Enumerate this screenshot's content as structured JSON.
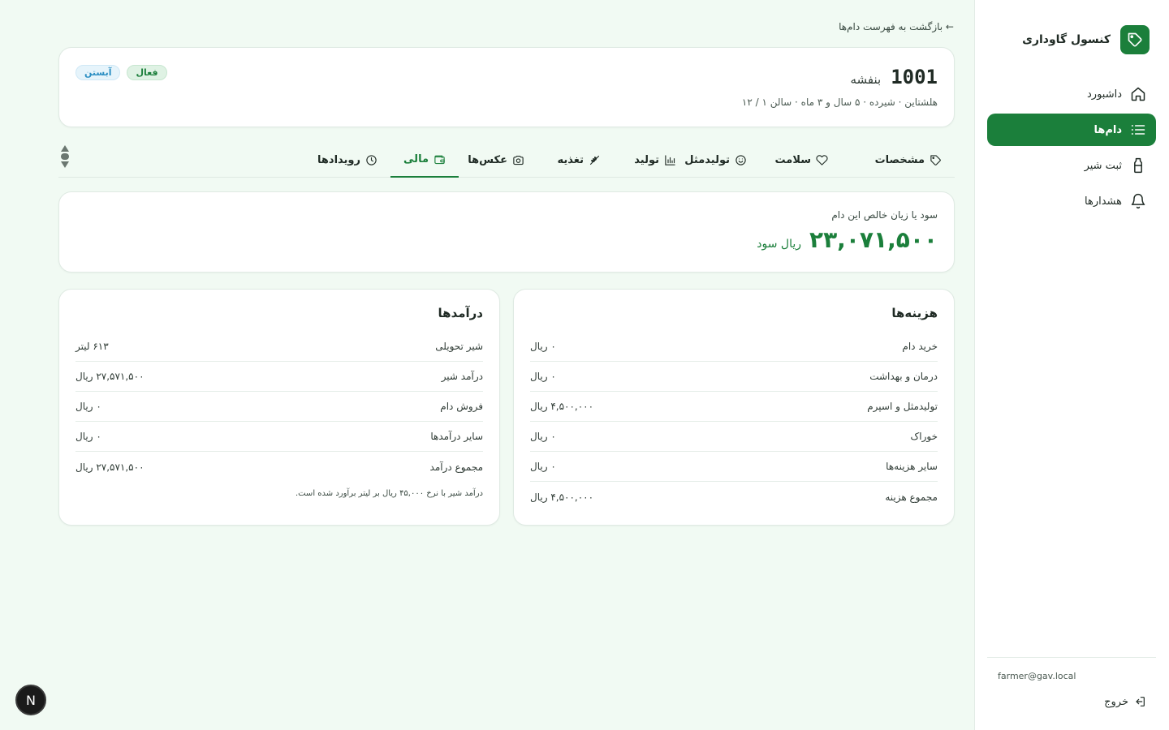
{
  "sidebar": {
    "brand": "کنسول گاوداری",
    "items": [
      {
        "label": "داشبورد",
        "icon": "home-icon",
        "active": false
      },
      {
        "label": "دام‌ها",
        "icon": "list-icon",
        "active": true
      },
      {
        "label": "ثبت شیر",
        "icon": "bottle-icon",
        "active": false
      },
      {
        "label": "هشدارها",
        "icon": "bell-icon",
        "active": false
      }
    ],
    "user_email": "farmer@gav.local",
    "logout_label": "خروج"
  },
  "back_link": "← بازگشت به فهرست دام‌ها",
  "animal": {
    "id": "1001",
    "name": "بنفشه",
    "info": "هلشتاین · شیرده · ۵ سال و ۳ ماه · سالن ۱ / ۱۲",
    "badges": {
      "active": "فعال",
      "pregnant": "آبستن"
    }
  },
  "tabs": [
    {
      "label": "مشخصات",
      "icon": "tag-icon"
    },
    {
      "label": "سلامت",
      "icon": "heart-icon"
    },
    {
      "label": "تولیدمثل",
      "icon": "smile-icon"
    },
    {
      "label": "تولید",
      "icon": "bar-chart-icon"
    },
    {
      "label": "تغذیه",
      "icon": "wheat-icon"
    },
    {
      "label": "عکس‌ها",
      "icon": "camera-icon"
    },
    {
      "label": "مالی",
      "icon": "wallet-icon",
      "active": true
    },
    {
      "label": "رویدادها",
      "icon": "clock-icon"
    }
  ],
  "profit": {
    "label": "سود یا زیان خالص این دام",
    "value": "۲۳,۰۷۱,۵۰۰",
    "unit": "ریال سود"
  },
  "costs": {
    "title": "هزینه‌ها",
    "rows": [
      {
        "label": "خرید دام",
        "value": "۰ ریال"
      },
      {
        "label": "درمان و بهداشت",
        "value": "۰ ریال"
      },
      {
        "label": "تولیدمثل و اسپرم",
        "value": "۴,۵۰۰,۰۰۰ ریال"
      },
      {
        "label": "خوراک",
        "value": "۰ ریال"
      },
      {
        "label": "سایر هزینه‌ها",
        "value": "۰ ریال"
      },
      {
        "label": "مجموع هزینه",
        "value": "۴,۵۰۰,۰۰۰ ریال"
      }
    ]
  },
  "incomes": {
    "title": "درآمدها",
    "rows": [
      {
        "label": "شیر تحویلی",
        "value": "۶۱۳ لیتر"
      },
      {
        "label": "درآمد شیر",
        "value": "۲۷,۵۷۱,۵۰۰ ریال"
      },
      {
        "label": "فروش دام",
        "value": "۰ ریال"
      },
      {
        "label": "سایر درآمدها",
        "value": "۰ ریال"
      },
      {
        "label": "مجموع درآمد",
        "value": "۲۷,۵۷۱,۵۰۰ ریال"
      }
    ],
    "note": "درآمد شیر با نرخ ۴۵,۰۰۰ ریال بر لیتر برآورد شده است."
  },
  "dev_badge": "N",
  "colors": {
    "accent": "#1b7f3b",
    "background": "#f1faf3"
  }
}
